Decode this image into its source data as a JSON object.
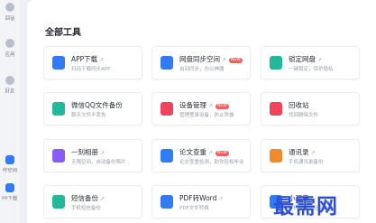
{
  "sidebar": {
    "items": [
      {
        "label": "回话",
        "icon": "chat-icon"
      },
      {
        "label": "应用",
        "icon": "apps-icon"
      },
      {
        "label": "好友",
        "icon": "contacts-icon"
      },
      {
        "label": "传空间",
        "icon": "cloud-icon"
      },
      {
        "label": "PP下载",
        "icon": "download-icon"
      }
    ]
  },
  "main": {
    "section_title": "全部工具",
    "badge_new": "NEW",
    "tools": [
      {
        "title": "APP下载",
        "desc": "扫码下载同步APP",
        "icon_color": "#2f7cf6"
      },
      {
        "title": "网盘同步空间",
        "desc": "自动同步，办公神器",
        "icon_color": "#2f7cf6",
        "new": true
      },
      {
        "title": "锁定网盘",
        "desc": "一键锁定，保护隐私",
        "icon_color": "#22b89a"
      },
      {
        "title": "微信QQ文件备份",
        "desc": "聊天文件不丢失",
        "icon_color": "#22b89a"
      },
      {
        "title": "设备管理",
        "desc": "管理登录设备，防止泄露",
        "icon_color": "#f0445a",
        "new": true
      },
      {
        "title": "回收站",
        "desc": "找回删除文件",
        "icon_color": "#f0445a"
      },
      {
        "title": "一刻相册",
        "desc": "无限空间，自动备份照片",
        "icon_color": "#8a5cf6"
      },
      {
        "title": "论文查重",
        "desc": "论文查重检测，助你轻松毕业",
        "icon_color": "#2f7cf6",
        "new": true
      },
      {
        "title": "通讯录",
        "desc": "手机通讯录备份",
        "icon_color": "#f08a2a"
      },
      {
        "title": "短信备份",
        "desc": "手机短信备份",
        "icon_color": "#22b89a"
      },
      {
        "title": "PDF转Word",
        "desc": "PDF文件转换",
        "icon_color": "#2f7cf6"
      },
      {
        "title": "小程序",
        "desc": "手机备份，轻松办公",
        "icon_color": "#2f7cf6"
      }
    ]
  },
  "watermark": "最需网"
}
